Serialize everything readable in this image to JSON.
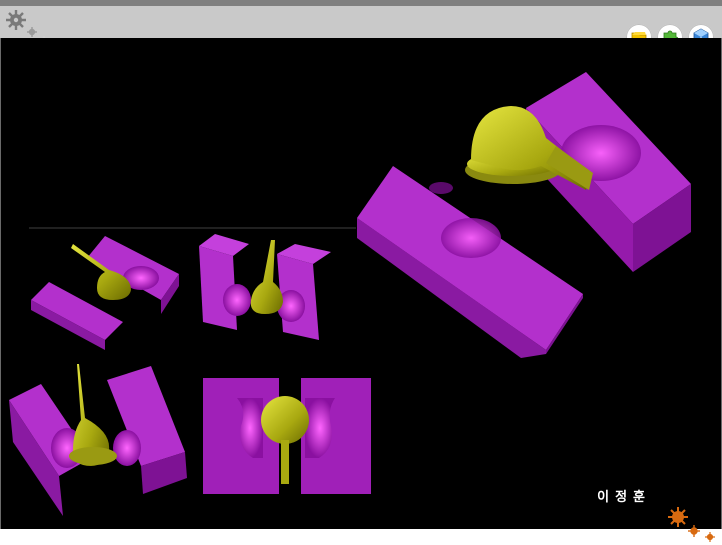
{
  "header": {
    "nav_buttons": [
      {
        "icon": "folder-icon",
        "color": "#f2c200"
      },
      {
        "icon": "puzzle-icon",
        "color": "#55b83a"
      },
      {
        "icon": "cube-icon",
        "color": "#3a86d8"
      }
    ]
  },
  "caption": {
    "author": "이정훈"
  },
  "colors": {
    "mold": "#b020c8",
    "part": "#b8b818",
    "background": "#000000",
    "accent_deco": "#d86a10"
  }
}
